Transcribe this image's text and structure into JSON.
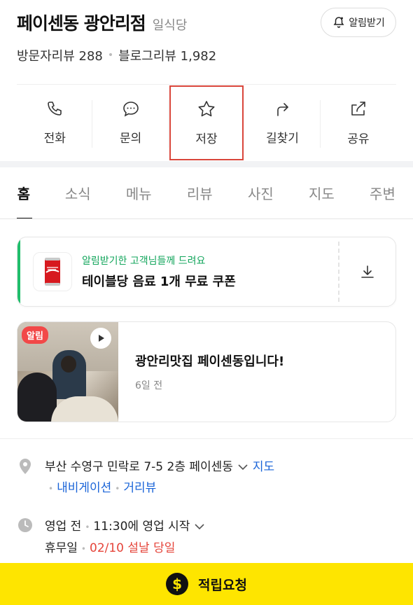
{
  "header": {
    "title": "페이센동 광안리점",
    "category": "일식당",
    "notify_label": "알림받기",
    "visitor_reviews": "방문자리뷰 288",
    "blog_reviews": "블로그리뷰 1,982"
  },
  "actions": [
    {
      "label": "전화",
      "icon": "phone-icon"
    },
    {
      "label": "문의",
      "icon": "chat-icon"
    },
    {
      "label": "저장",
      "icon": "star-icon"
    },
    {
      "label": "길찾기",
      "icon": "directions-icon"
    },
    {
      "label": "공유",
      "icon": "share-icon"
    }
  ],
  "tabs": [
    "홈",
    "소식",
    "메뉴",
    "리뷰",
    "사진",
    "지도",
    "주변"
  ],
  "coupon": {
    "subtitle": "알림받기한 고객님들께 드려요",
    "title": "테이블당 음료 1개 무료 쿠폰",
    "accent": "#1fbe6b"
  },
  "post": {
    "badge": "알림",
    "title": "광안리맛집 페이센동입니다!",
    "time": "6일 전"
  },
  "address": {
    "text": "부산 수영구 민락로 7-5 2층 페이센동",
    "map_link": "지도",
    "nav_link": "내비게이션",
    "street_link": "거리뷰"
  },
  "hours": {
    "status": "영업 전",
    "start": "11:30에 영업 시작",
    "holiday_label": "휴무일",
    "holiday_value": "02/10 설날 당일"
  },
  "bottom": {
    "label": "적립요청",
    "color": "#fee500"
  }
}
